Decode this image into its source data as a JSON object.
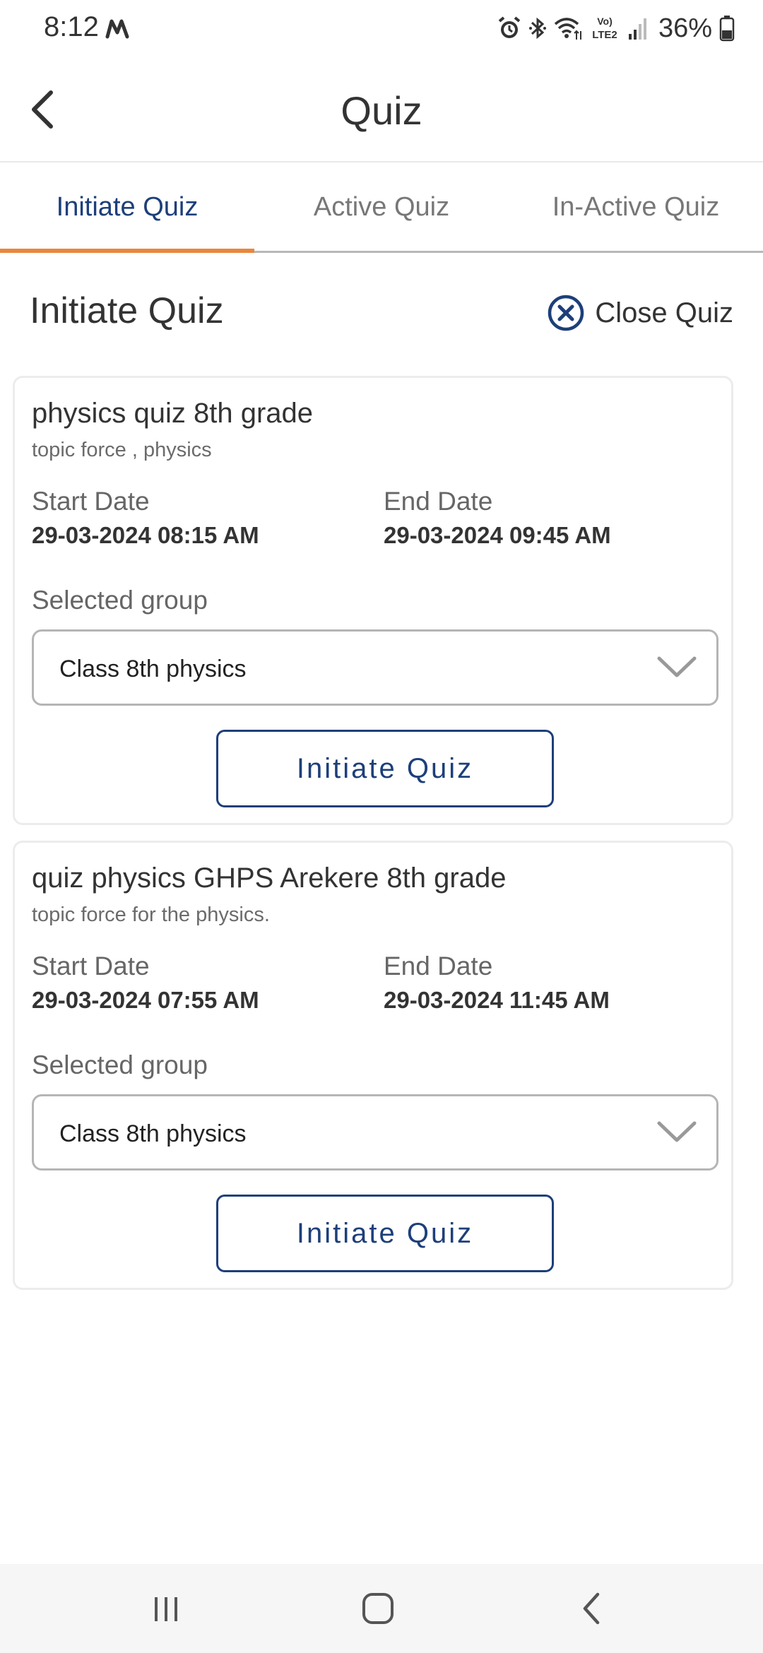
{
  "status_bar": {
    "time": "8:12",
    "carrier_icon": "m-logo-icon",
    "icons": [
      "alarm-icon",
      "bluetooth-icon",
      "wifi-icon",
      "volte-lte2-icon",
      "signal-icon"
    ],
    "volte_text": "Vo)",
    "lte_text": "LTE2",
    "battery_percent": "36%"
  },
  "header": {
    "title": "Quiz",
    "back_icon": "chevron-left-icon"
  },
  "tabs": [
    {
      "label": "Initiate Quiz",
      "active": true
    },
    {
      "label": "Active Quiz",
      "active": false
    },
    {
      "label": "In-Active Quiz",
      "active": false
    }
  ],
  "section": {
    "title": "Initiate Quiz",
    "close_label": "Close Quiz",
    "close_icon": "close-circle-icon"
  },
  "quizzes": [
    {
      "title": "physics quiz 8th grade",
      "topic": "topic force , physics",
      "start_label": "Start Date",
      "start_value": "29-03-2024 08:15 AM",
      "end_label": "End Date",
      "end_value": "29-03-2024 09:45 AM",
      "group_label": "Selected group",
      "group_value": "Class 8th physics",
      "button_label": "Initiate Quiz"
    },
    {
      "title": "quiz physics GHPS Arekere 8th grade",
      "topic": "topic force for the physics.",
      "start_label": "Start Date",
      "start_value": "29-03-2024 07:55 AM",
      "end_label": "End Date",
      "end_value": "29-03-2024 11:45 AM",
      "group_label": "Selected group",
      "group_value": "Class 8th physics",
      "button_label": "Initiate Quiz"
    }
  ],
  "nav_bar": {
    "buttons": [
      "recents-icon",
      "home-icon",
      "back-icon"
    ]
  },
  "colors": {
    "accent_blue": "#1d3f7a",
    "tab_underline": "#e8873e"
  }
}
